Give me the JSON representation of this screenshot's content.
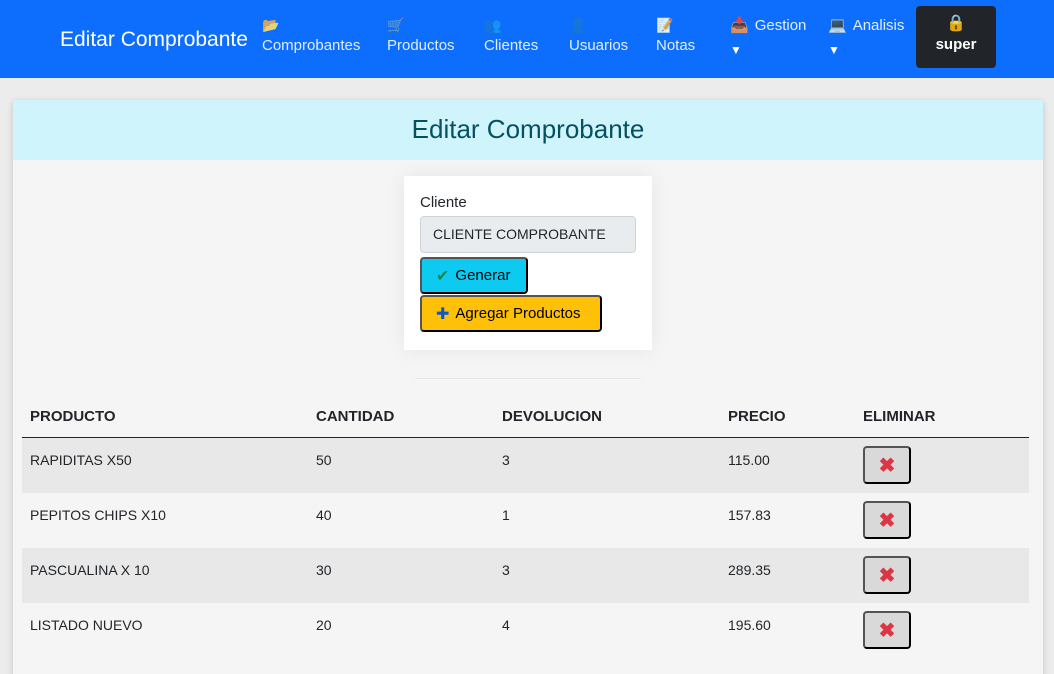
{
  "navbar": {
    "brand": "Editar Comprobante",
    "items": [
      {
        "label": "Comprobantes",
        "icon": "folder-icon",
        "glyph": "📂"
      },
      {
        "label": "Productos",
        "icon": "shopping-cart-icon",
        "glyph": "🛒"
      },
      {
        "label": "Clientes",
        "icon": "clients-icon",
        "glyph": "👥"
      },
      {
        "label": "Usuarios",
        "icon": "user-icon",
        "glyph": "👤"
      },
      {
        "label": "Notas",
        "icon": "notes-icon",
        "glyph": "📝"
      }
    ],
    "dropdowns": [
      {
        "label": "Gestion",
        "icon": "gestion-icon",
        "glyph": "📥",
        "caret": "▼"
      },
      {
        "label": "Analisis",
        "icon": "laptop-icon",
        "glyph": "💻",
        "caret": "▼"
      }
    ],
    "user": {
      "name": "super",
      "icon": "lock-icon",
      "glyph": "🔒"
    }
  },
  "page": {
    "title": "Editar Comprobante"
  },
  "form": {
    "client_label": "Cliente",
    "client_value": "CLIENTE COMPROBANTE",
    "generate_label": "Generar",
    "generate_icon": "check-icon",
    "generate_glyph": "✔",
    "add_products_label": "Agregar Productos",
    "add_products_icon": "plus-icon",
    "add_products_glyph": "✚"
  },
  "table": {
    "headers": [
      "PRODUCTO",
      "CANTIDAD",
      "DEVOLUCION",
      "PRECIO",
      "ELIMINAR"
    ],
    "rows": [
      {
        "producto": "RAPIDITAS X50",
        "cantidad": "50",
        "devolucion": "3",
        "precio": "115.00"
      },
      {
        "producto": "PEPITOS CHIPS X10",
        "cantidad": "40",
        "devolucion": "1",
        "precio": "157.83"
      },
      {
        "producto": "PASCUALINA X 10",
        "cantidad": "30",
        "devolucion": "3",
        "precio": "289.35"
      },
      {
        "producto": "LISTADO NUEVO",
        "cantidad": "20",
        "devolucion": "4",
        "precio": "195.60"
      }
    ],
    "delete_icon": "delete-x-icon",
    "delete_glyph": "✖"
  },
  "colors": {
    "navbar": "#0d6efd",
    "header_bg": "#cff4fc",
    "header_text": "#055160",
    "generate": "#0dcaf0",
    "add": "#ffc107",
    "delete": "#dc3545"
  }
}
